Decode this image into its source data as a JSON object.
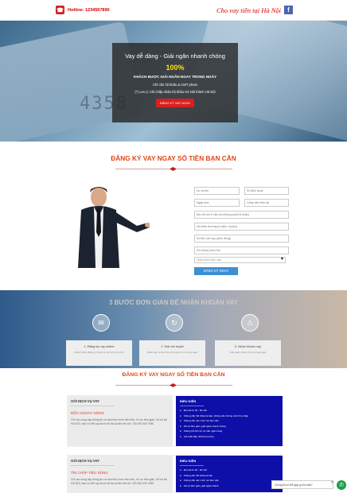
{
  "topbar": {
    "hotline": "Hotline: 1234567890",
    "brand": "Cho vay tiền tại Hà Nội",
    "fb": "f"
  },
  "hero": {
    "card_number": "4358",
    "headline": "Vay dễ dàng - Giải ngân nhanh chóng",
    "percent": "100%",
    "line1": "KHÁCH ĐƯỢC GIẢI NGÂN NGAY TRONG NGÀY",
    "line2": "Chỉ cần hộ khẩu & CMT photo",
    "line3": "(*) Lưu ý: Chỉ chấp nhận hộ khẩu Hà Nội thành Hà Nội",
    "button": "ĐĂNG KÝ VAY NGAY"
  },
  "form": {
    "title": "ĐĂNG KÝ VAY NGAY SỐ TIỀN BẠN CẦN",
    "f1": "Họ và tên",
    "f2": "Số điện thoại",
    "f3": "Ngày sinh",
    "f4": "Công việc hiện tại",
    "f5": "Địa chỉ nơi ở hiện tại (không phải hộ khẩu)",
    "f6": "Hộ khẩu thường trú (tỉnh, huyện)",
    "f7": "Số tiền cần vay (triệu đồng)",
    "f8": "Số chứng minh thư",
    "f9": "Lĩnh vực vay",
    "f10": "Chọn hình thức vay",
    "chevron": "▾",
    "submit": "ĐĂNG KÝ NGAY"
  },
  "steps": {
    "title": "3 BƯỚC ĐƠN GIẢN ĐỂ NHẬN KHOẢN VAY",
    "icons": [
      "✉",
      "↻",
      "⚠"
    ],
    "items": [
      {
        "t": "1. Đăng ký vay online",
        "d": "Khách hàng đăng ký thông tin tại form bên trên"
      },
      {
        "t": "2. Đợi xét duyệt",
        "d": "Nhân viên sẽ liên hệ xét duyệt hồ sơ trong ngày"
      },
      {
        "t": "3. Nhận khoản vay",
        "d": "Giải ngân nhanh chóng trong ngày"
      }
    ]
  },
  "packages": {
    "title": "ĐĂNG KÝ VAY NGAY SỐ TIỀN BẠN CẦN",
    "items": [
      {
        "tag": "GÓI DỊCH VỤ VAY",
        "name": "BỐC HỌ/VAY NÓNG",
        "desc": "Chỉ cần cung cấp thông tin cơ bản theo form bên trên, hồ sơ đơn giản, hỗ trợ tại HÀ NỘI, bạn có thể vay được tối đa số tiền lên tới: 100.000.000 VNĐ",
        "cond_tag": "ĐIỀU KIỆN",
        "conds": [
          "Độ tuổi từ 20 - 60 tuổi",
          "Không cần thế chấp tài sản, không cần chứng minh thu nhập",
          "Không cần xác minh nơi làm việc",
          "Hồ sơ đơn giản, giải ngân nhanh chóng",
          "Không hỏi lịch sử nợ xấu ngân hàng",
          "Lãi suất thấp nhất thị trường"
        ]
      },
      {
        "tag": "GÓI DỊCH VỤ VAY",
        "name": "TÍN CHẤP TIÊU DÙNG",
        "desc": "Chỉ cần cung cấp thông tin cơ bản theo form bên trên, hồ sơ đơn giản, hỗ trợ tại HÀ NỘI, bạn có thể vay được tối đa số tiền lên tới: 200.000.000 VNĐ",
        "cond_tag": "ĐIỀU KIỆN",
        "conds": [
          "Độ tuổi từ 20 - 60 tuổi",
          "Không cần thế chấp tài sản",
          "Không cần xác minh nơi làm việc",
          "Hồ sơ đơn giản, giải ngân nhanh",
          "Không hỏi lịch sử nợ xấu",
          "Lãi suất thấp"
        ]
      }
    ]
  },
  "chat": {
    "text": "Chúng tôi có thể giúp gì cho bạn?",
    "close": "×",
    "phone": "✆"
  }
}
